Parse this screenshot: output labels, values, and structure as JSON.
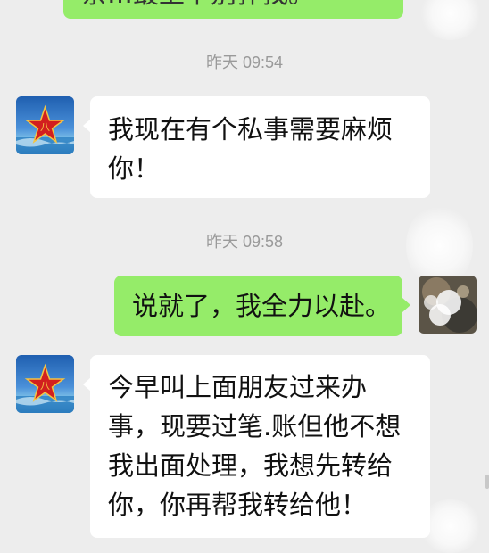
{
  "chat": {
    "top_message_partial": "亲…最上下别扑找。",
    "timestamps": [
      "昨天 09:54",
      "昨天 09:58"
    ],
    "messages": [
      {
        "text": "我现在有个私事需要麻烦你！"
      },
      {
        "text": "说就了，我全力以赴。"
      },
      {
        "text": "今早叫上面朋友过来办事，现要过笔.账但他不想我出面处理，我想先转给你，你再帮我转给他！"
      }
    ]
  },
  "colors": {
    "background": "#ededed",
    "incoming_bubble": "#ffffff",
    "outgoing_bubble": "#95ec69",
    "timestamp_text": "#9a9a9a"
  },
  "icons": {
    "contact_avatar": "red-star-emblem-avatar",
    "self_avatar": "blurred-photo-avatar"
  }
}
